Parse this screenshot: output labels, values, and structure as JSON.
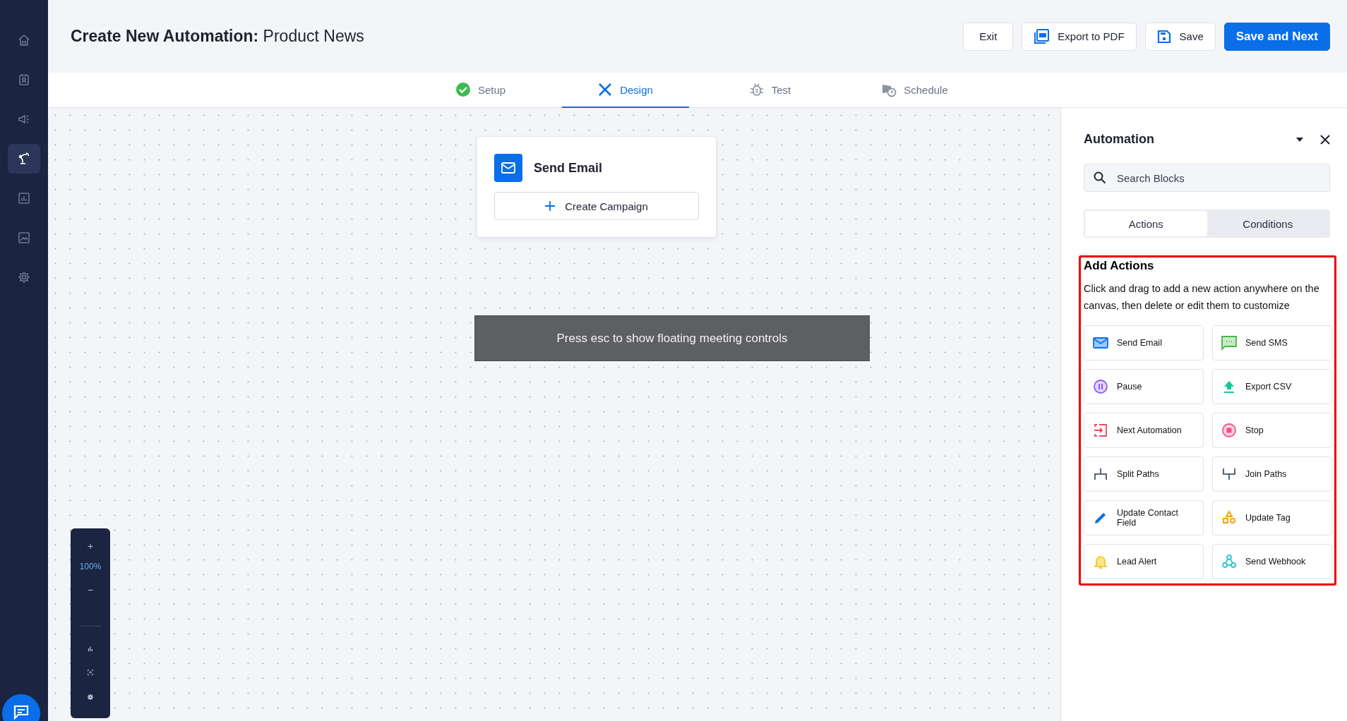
{
  "sidebar": {
    "items": [
      {
        "selected": false
      },
      {
        "selected": false
      },
      {
        "selected": false
      },
      {
        "selected": true
      },
      {
        "selected": false
      },
      {
        "selected": false
      },
      {
        "selected": false
      }
    ]
  },
  "header": {
    "title_bold": "Create New Automation:",
    "title_name": "Product News",
    "buttons": [
      {
        "label": "Exit",
        "kind": "plain"
      },
      {
        "label": "Export to PDF",
        "kind": "pdf"
      },
      {
        "label": "Save",
        "kind": "save"
      },
      {
        "label": "Save and Next",
        "kind": "primary"
      }
    ]
  },
  "steps": [
    {
      "label": "Setup",
      "selected": false
    },
    {
      "label": "Design",
      "selected": true
    },
    {
      "label": "Test",
      "selected": false
    },
    {
      "label": "Schedule",
      "selected": false
    }
  ],
  "canvas": {
    "node": {
      "title": "Send Email",
      "button": "Create Campaign"
    },
    "toast": "Press esc to show floating meeting controls",
    "zoom": "100%"
  },
  "panel": {
    "title": "Automation",
    "search": {
      "placeholder": "Search Blocks"
    },
    "tabs": [
      {
        "label": "Actions",
        "selected": true
      },
      {
        "label": "Conditions",
        "selected": false
      }
    ],
    "section_title": "Add Actions",
    "section_text": "Click and drag to add a new action anywhere on the canvas, then delete or edit them to customize",
    "actions": [
      {
        "label": "Send Email"
      },
      {
        "label": "Send SMS"
      },
      {
        "label": "Pause"
      },
      {
        "label": "Export CSV"
      },
      {
        "label": "Next Automation"
      },
      {
        "label": "Stop"
      },
      {
        "label": "Split Paths"
      },
      {
        "label": "Join Paths"
      },
      {
        "label": "Update Contact Field"
      },
      {
        "label": "Update Tag"
      },
      {
        "label": "Lead Alert"
      },
      {
        "label": "Send Webhook"
      }
    ]
  }
}
